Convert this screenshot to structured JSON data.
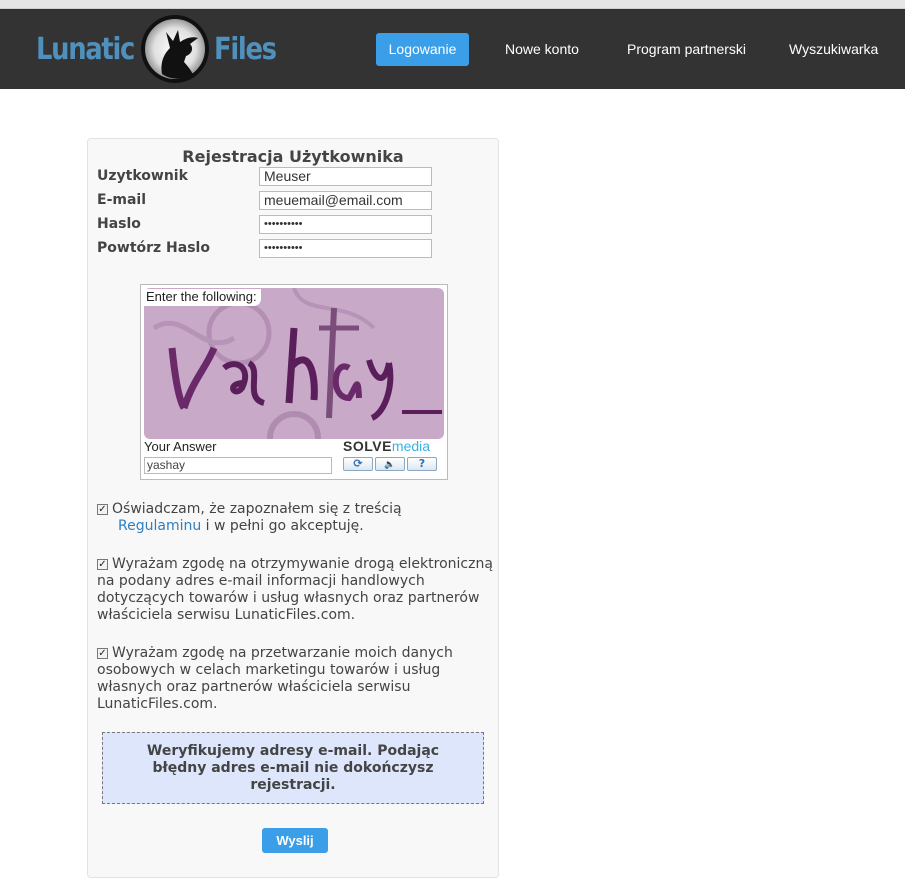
{
  "header": {
    "logo_left": "Lunatic",
    "logo_right": "Files",
    "nav": {
      "login": "Logowanie",
      "new_account": "Nowe konto",
      "partner": "Program partnerski",
      "search": "Wyszukiwarka"
    }
  },
  "form": {
    "title": "Rejestracja Użytkownika",
    "fields": {
      "username": {
        "label": "Uzytkownik",
        "value": "Meuser"
      },
      "email": {
        "label": "E-mail",
        "value": "meuemail@email.com"
      },
      "password": {
        "label": "Haslo",
        "value": "••••••••••"
      },
      "password_repeat": {
        "label": "Powtórz Haslo",
        "value": "••••••••••"
      }
    },
    "captcha": {
      "prompt": "Enter the following:",
      "answer_label": "Your Answer",
      "answer_value": "yashay",
      "brand_solve": "SOLVE",
      "brand_media": "media",
      "buttons": {
        "refresh": "⟳",
        "audio": "🔈",
        "help": "?"
      }
    },
    "consents": [
      {
        "checked": true,
        "text_before": "Oświadczam, że zapoznałem się z treścią",
        "link": "Regulaminu",
        "text_after": "i w pełni go akceptuję."
      },
      {
        "checked": true,
        "text": "Wyrażam zgodę na otrzymywanie drogą elektroniczną na podany adres e-mail informacji handlowych dotyczących towarów i usług własnych oraz partnerów właściciela serwisu LunaticFiles.com."
      },
      {
        "checked": true,
        "text": "Wyrażam zgodę na przetwarzanie moich danych osobowych w celach marketingu towarów i usług własnych oraz partnerów właściciela serwisu LunaticFiles.com."
      }
    ],
    "notice": "Weryfikujemy adresy e-mail. Podając błędny adres e-mail nie dokończysz rejestracji.",
    "submit": "Wyslij"
  },
  "colors": {
    "navbar": "#333333",
    "accent": "#3a9ee8",
    "logo": "#4f90bd",
    "notice_bg": "#dde6fb"
  }
}
